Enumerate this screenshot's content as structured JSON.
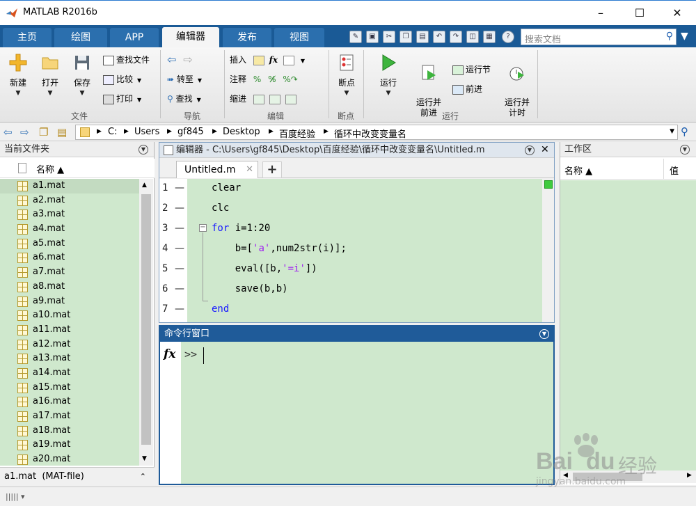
{
  "window": {
    "title": "MATLAB R2016b"
  },
  "tabs": [
    "主页",
    "绘图",
    "APP",
    "编辑器",
    "发布",
    "视图"
  ],
  "search": {
    "placeholder": "搜索文档"
  },
  "ribbon": {
    "file": {
      "new": "新建",
      "open": "打开",
      "save": "保存",
      "find_files": "查找文件",
      "compare": "比较",
      "print": "打印",
      "label": "文件"
    },
    "navigate": {
      "goto": "转至",
      "find": "查找",
      "label": "导航"
    },
    "edit": {
      "insert": "插入",
      "comment": "注释",
      "indent": "缩进",
      "fx": "fx",
      "label": "编辑"
    },
    "breakpoints": {
      "breakpoints": "断点",
      "label": "断点"
    },
    "run": {
      "run": "运行",
      "run_advance": "运行并\n前进",
      "run_section": "运行节",
      "advance": "前进",
      "run_time": "运行并\n计时",
      "label": "运行"
    }
  },
  "address": {
    "crumbs": [
      "C:",
      "Users",
      "gf845",
      "Desktop",
      "百度经验",
      "循环中改变变量名"
    ]
  },
  "file_browser": {
    "title": "当前文件夹",
    "col_name": "名称 ▲",
    "files": [
      "a1.mat",
      "a2.mat",
      "a3.mat",
      "a4.mat",
      "a5.mat",
      "a6.mat",
      "a7.mat",
      "a8.mat",
      "a9.mat",
      "a10.mat",
      "a11.mat",
      "a12.mat",
      "a13.mat",
      "a14.mat",
      "a15.mat",
      "a16.mat",
      "a17.mat",
      "a18.mat",
      "a19.mat",
      "a20.mat"
    ],
    "details": "a1.mat  (MAT-file)"
  },
  "editor": {
    "title": "编辑器 - C:\\Users\\gf845\\Desktop\\百度经验\\循环中改变变量名\\Untitled.m",
    "tab": "Untitled.m",
    "lines": [
      {
        "n": "1",
        "code": [
          {
            "t": "clear",
            "c": "plain"
          }
        ]
      },
      {
        "n": "2",
        "code": [
          {
            "t": "clc",
            "c": "plain"
          }
        ]
      },
      {
        "n": "3",
        "code": [
          {
            "t": "for",
            "c": "kw"
          },
          {
            "t": " i=1:20",
            "c": "plain"
          }
        ]
      },
      {
        "n": "4",
        "code": [
          {
            "t": "    b=[",
            "c": "plain"
          },
          {
            "t": "'a'",
            "c": "str"
          },
          {
            "t": ",num2str(i)];",
            "c": "plain"
          }
        ]
      },
      {
        "n": "5",
        "code": [
          {
            "t": "    eval([b,",
            "c": "plain"
          },
          {
            "t": "'=i'",
            "c": "str"
          },
          {
            "t": "])",
            "c": "plain"
          }
        ]
      },
      {
        "n": "6",
        "code": [
          {
            "t": "    save(b,b)",
            "c": "plain"
          }
        ]
      },
      {
        "n": "7",
        "code": [
          {
            "t": "end",
            "c": "kw"
          }
        ]
      }
    ]
  },
  "command_window": {
    "title": "命令行窗口",
    "fx": "fx",
    "prompt": ">>"
  },
  "workspace": {
    "title": "工作区",
    "col_name": "名称 ▲",
    "col_value": "值"
  },
  "watermark": {
    "brand": "Bai",
    "brand2": "du",
    "brand_cn": "经验",
    "url": "jingyan.baidu.com"
  },
  "colors": {
    "accent": "#1f5b99",
    "code_bg": "#cfe8cd",
    "keyword": "#1a1aff",
    "string": "#a020f0"
  }
}
